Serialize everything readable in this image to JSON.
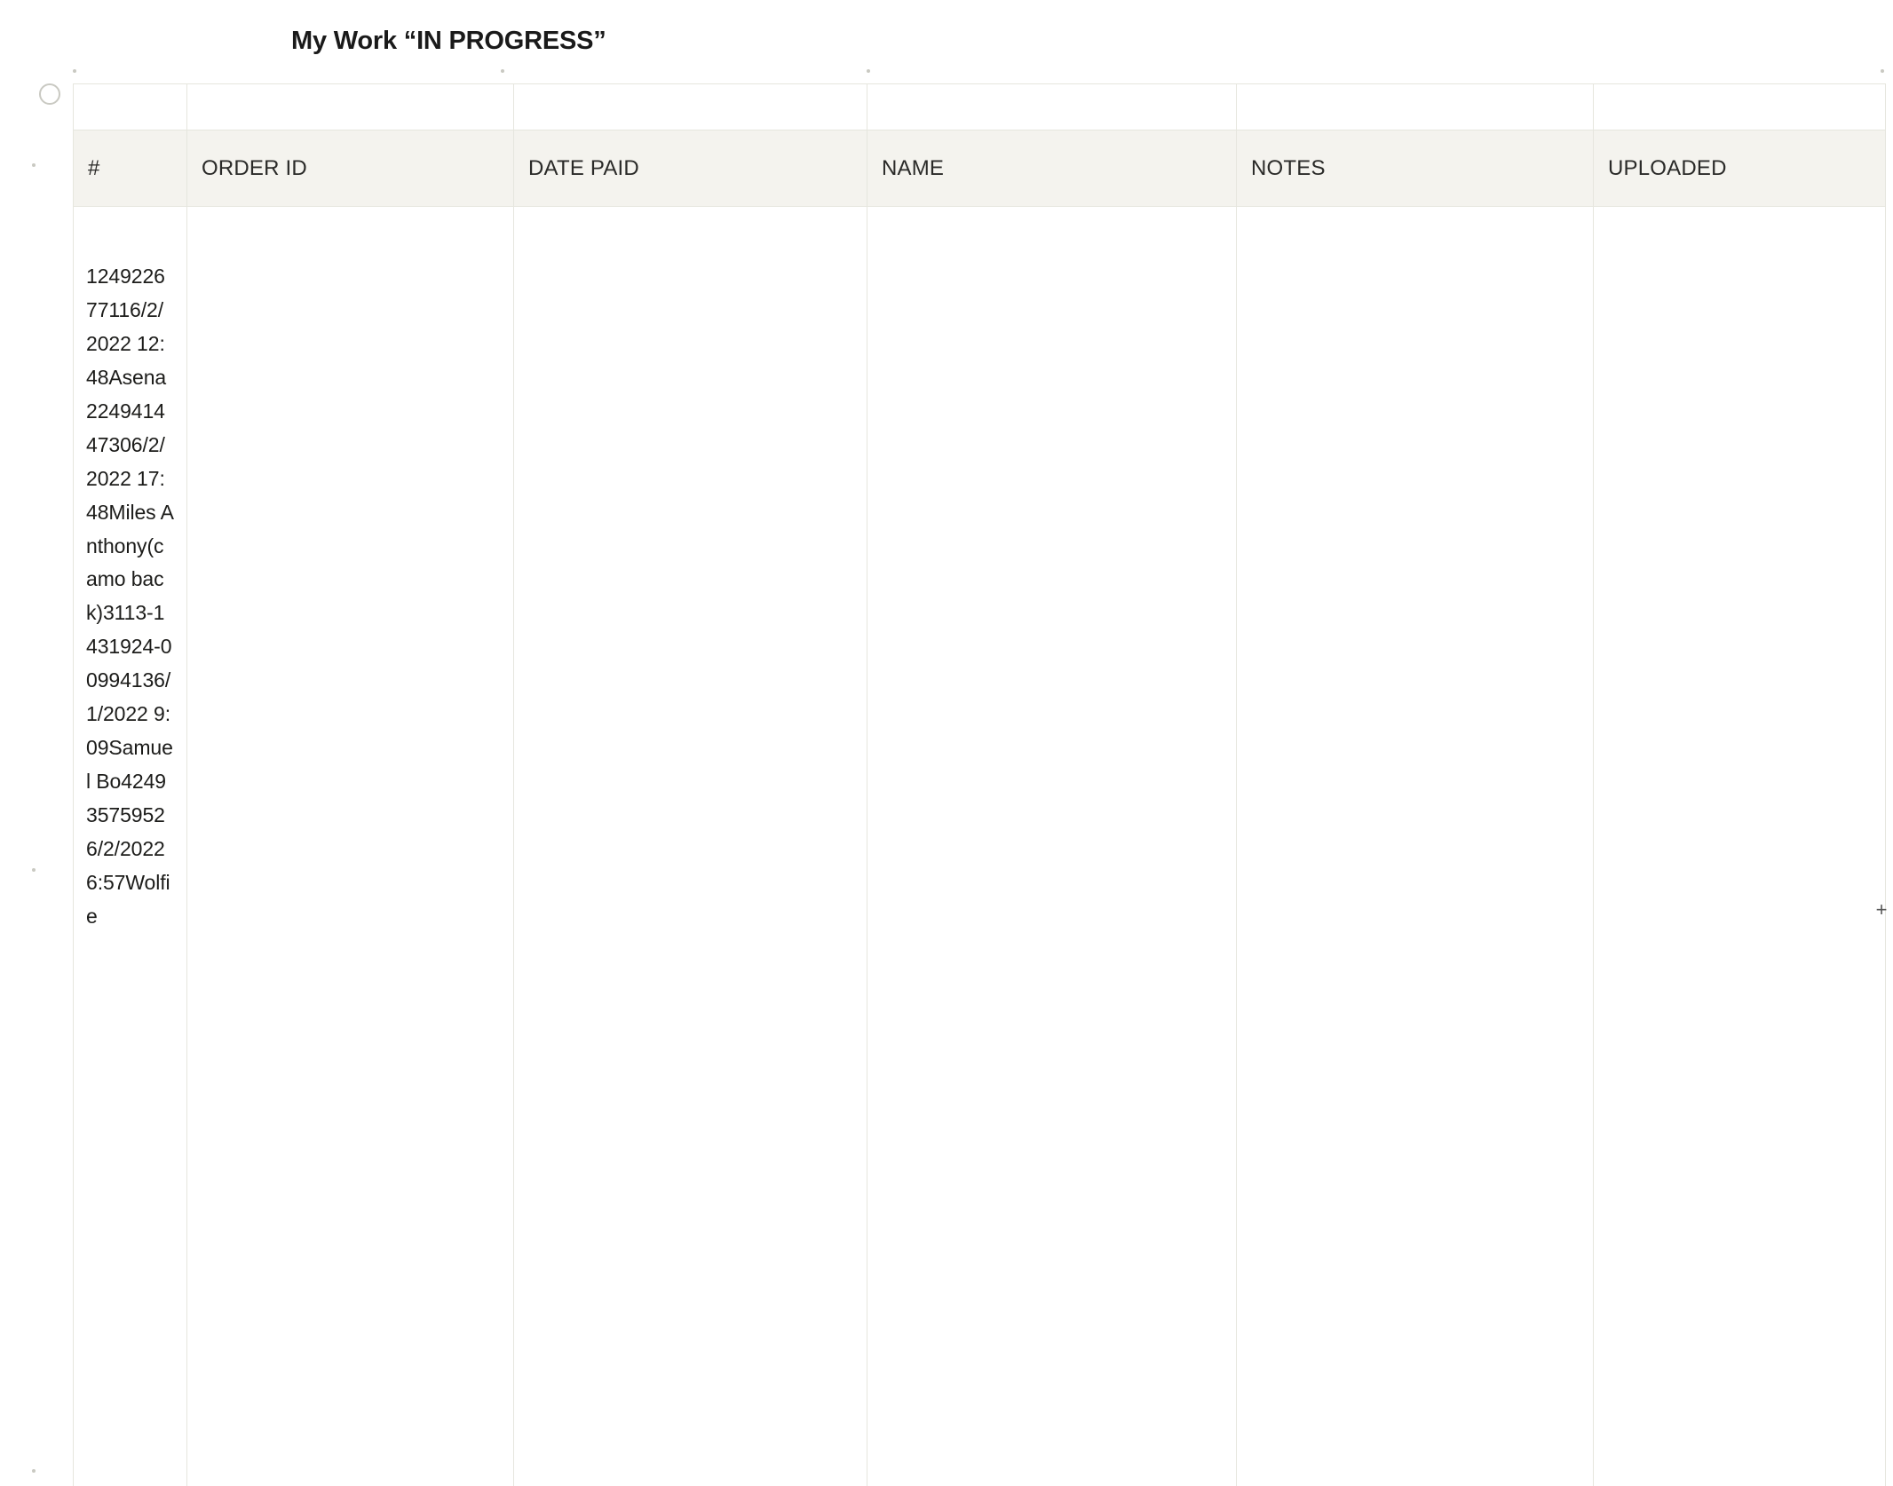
{
  "title": "My Work “IN PROGRESS”",
  "columns": {
    "num": "#",
    "order_id": "ORDER ID",
    "date_paid": "DATE PAID",
    "name": "NAME",
    "notes": "NOTES",
    "uploaded": "UPLOADED"
  },
  "raw_cell_text": "124922677116/2/2022 12:48Asena224941447306/2/2022 17:48Miles Anthony(camo back)3113-1431924-00994136/1/2022 9:09Samuel Bo424935759526/2/2022 6:57Wolfie",
  "parsed_rows": [
    {
      "num": 1,
      "order_id": "2492",
      "alt_id": "26771",
      "date_paid": "16/2/2022 12:48",
      "name": "Asena",
      "notes": "",
      "uploaded": ""
    },
    {
      "num": 2,
      "order_id": "2494",
      "alt_id": "14473",
      "date_paid": "06/2/2022 17:48",
      "name": "Miles Anthony",
      "notes": "(camo back)",
      "uploaded": ""
    },
    {
      "num": 3,
      "order_id": "113-1431924-0099413",
      "alt_id": "",
      "date_paid": "6/1/2022 9:09",
      "name": "Samuel Bo",
      "notes": "",
      "uploaded": ""
    },
    {
      "num": 4,
      "order_id": "2493",
      "alt_id": "57595",
      "date_paid": "26/2/2022 6:57",
      "name": "Wolfie",
      "notes": "",
      "uploaded": ""
    }
  ],
  "handles": {
    "plus_symbol": "+"
  }
}
